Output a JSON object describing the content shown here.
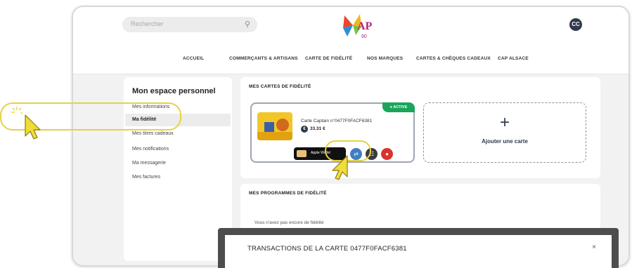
{
  "colors": {
    "highlight": "#e8d142",
    "cursor": "#f1dc3a",
    "status_active": "#1aa55a",
    "dark_navy": "#2f3a4c",
    "danger": "#d9332b"
  },
  "header": {
    "search_placeholder": "Rechercher",
    "search_icon": "search-icon",
    "logo_text": "CAP",
    "avatar_initials": "CC"
  },
  "nav": {
    "items": [
      "ACCUEIL",
      "COMMERÇANTS & ARTISANS",
      "CARTE DE FIDÉLITÉ",
      "NOS MARQUES",
      "CARTES & CHÈQUES CADEAUX",
      "CAP ALSACE"
    ]
  },
  "sidebar": {
    "title": "Mon espace personnel",
    "items": [
      "Mes informations",
      "Ma fidélité",
      "Mes titres cadeaux",
      "Mes notifications",
      "Ma messagerie",
      "Mes factures"
    ],
    "active_index": 1
  },
  "cards_section": {
    "title": "MES CARTES DE FIDÉLITÉ",
    "card": {
      "status": "● ACTIVE",
      "name": "Carte Captain n°0477F0FACF6381",
      "balance": "33.31 €",
      "wallet_label": "Apple Wallet",
      "balance_icon": "euro-coin-icon"
    },
    "add_card": {
      "plus": "+",
      "label": "Ajouter une carte"
    }
  },
  "programs_section": {
    "title": "MES PROGRAMMES DE FIDÉLITÉ",
    "empty_text": "Vous n'avez pas encore de fidélité"
  },
  "modal": {
    "title": "TRANSACTIONS DE LA CARTE 0477F0FACF6381",
    "close": "×"
  }
}
